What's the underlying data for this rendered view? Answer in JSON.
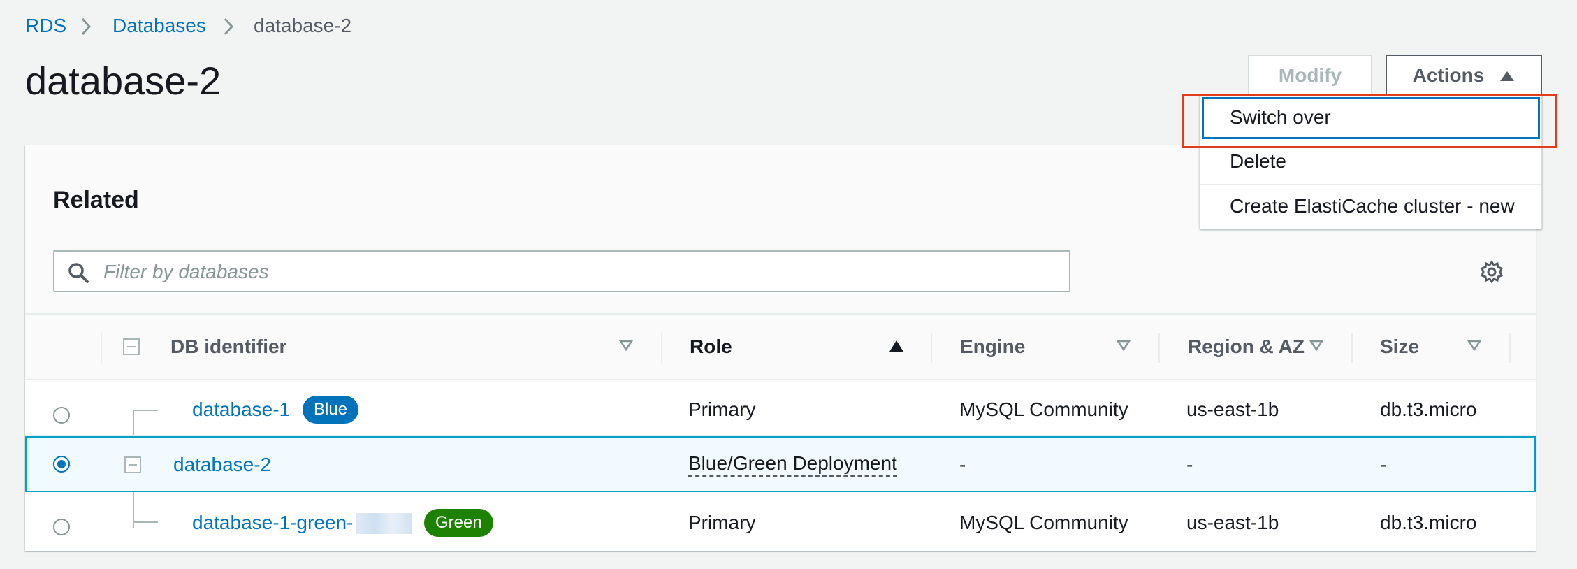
{
  "breadcrumb": {
    "items": [
      "RDS",
      "Databases",
      "database-2"
    ]
  },
  "page": {
    "title": "database-2"
  },
  "toolbar": {
    "modify_label": "Modify",
    "actions_label": "Actions"
  },
  "actions_menu": {
    "items": [
      "Switch over",
      "Delete",
      "Create ElastiCache cluster - new"
    ],
    "focused": "Switch over"
  },
  "related": {
    "title": "Related",
    "search_placeholder": "Filter by databases",
    "search_value": ""
  },
  "table": {
    "columns": [
      "DB identifier",
      "Role",
      "Engine",
      "Region & AZ",
      "Size"
    ],
    "sorted_column": "Role",
    "rows": [
      {
        "id": "database-1",
        "badge": "Blue",
        "role": "Primary",
        "engine": "MySQL Community",
        "region": "us-east-1b",
        "size": "db.t3.micro",
        "selected": false
      },
      {
        "id": "database-2",
        "badge": "",
        "role": "Blue/Green Deployment",
        "engine": "-",
        "region": "-",
        "size": "-",
        "selected": true
      },
      {
        "id": "database-1-green-",
        "badge": "Green",
        "role": "Primary",
        "engine": "MySQL Community",
        "region": "us-east-1b",
        "size": "db.t3.micro",
        "selected": false
      }
    ]
  },
  "colors": {
    "link": "#0073bb",
    "blue_badge": "#0073bb",
    "green_badge": "#1d8102",
    "highlight": "#e23b1d",
    "selected_row_bg": "#f1faff",
    "selected_row_border": "#00a1c9"
  },
  "icons": [
    "chevron-right-icon",
    "caret-up-icon",
    "search-icon",
    "gear-icon",
    "sort-down-icon",
    "sort-up-icon",
    "collapse-icon"
  ]
}
